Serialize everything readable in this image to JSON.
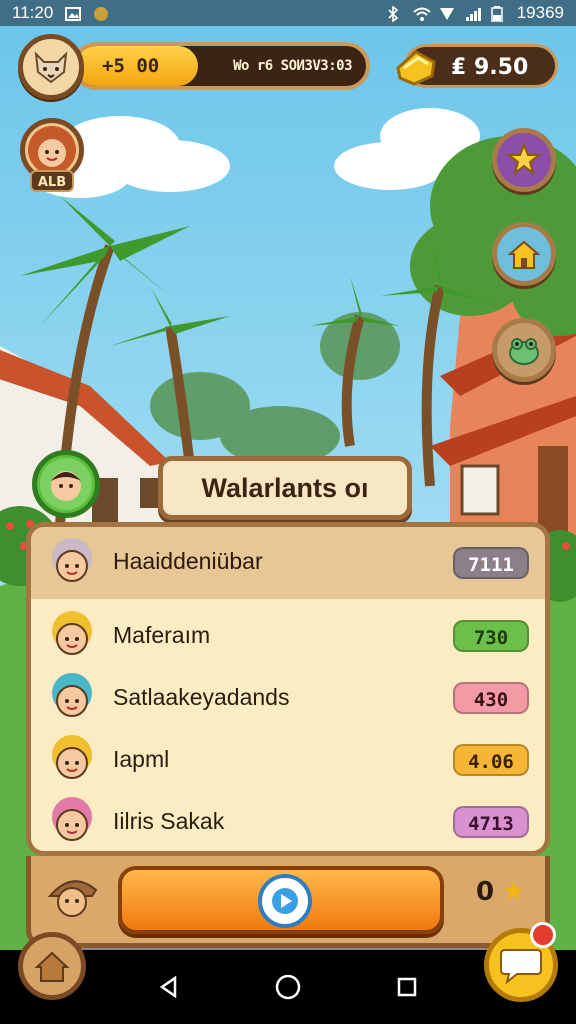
{
  "status_bar": {
    "time": "11:20",
    "right_text": "19369"
  },
  "hud": {
    "xp_value": "+5 00",
    "xp_text": "Wo r6 SOИ3V3:03",
    "xp_progress": 0.42,
    "coin_value": "₤ 9.50"
  },
  "profile": {
    "tag": "ALB"
  },
  "banner": {
    "title": "Walarlants oı"
  },
  "leaderboard": {
    "rows": [
      {
        "name": "Haaiddeniübar",
        "score": "7111",
        "score_bg": "#8c7f88",
        "score_fg": "#ffffff",
        "avatar_color": "#c9b9c4"
      },
      {
        "name": "Maferaım",
        "score": "730",
        "score_bg": "#6cc04a",
        "score_fg": "#1d3a10",
        "avatar_color": "#f0c030"
      },
      {
        "name": "Satlaakeyadands",
        "score": "430",
        "score_bg": "#f29aa6",
        "score_fg": "#3a1015",
        "avatar_color": "#48b7c8"
      },
      {
        "name": "Iapml",
        "score": "4.06",
        "score_bg": "#f6b534",
        "score_fg": "#3a2205",
        "avatar_color": "#f0c030"
      },
      {
        "name": "Iilris Sakak",
        "score": "4713",
        "score_bg": "#d991cf",
        "score_fg": "#3a1030",
        "avatar_color": "#e27aa9"
      }
    ]
  },
  "bottom": {
    "stars_count": "0"
  },
  "colors": {
    "accent": "#f4a50e",
    "panel": "#fcecc4",
    "frame": "#a57443"
  },
  "icons": {
    "hud_avatar": "fox-icon",
    "coin": "coin-stack-icon",
    "side_1": "star-badge-icon",
    "side_2": "house-icon",
    "side_3": "frog-icon",
    "play": "play-icon",
    "chat": "chat-bubble-icon"
  }
}
